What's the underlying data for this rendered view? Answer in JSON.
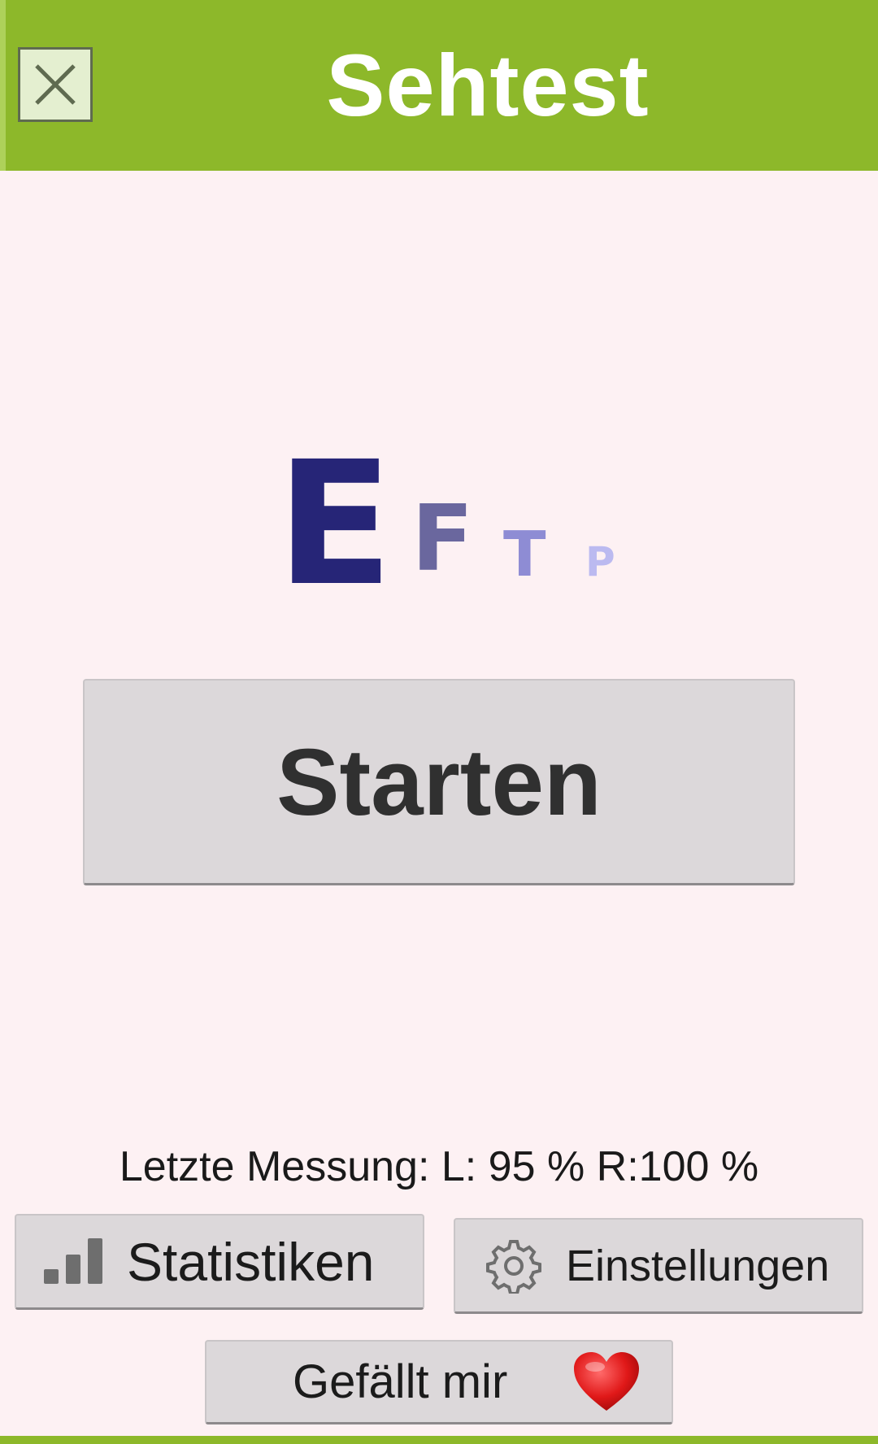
{
  "header": {
    "title": "Sehtest",
    "close_icon": "close-icon",
    "color": "#8db82a"
  },
  "logo": {
    "letters": [
      "E",
      "F",
      "T",
      "P"
    ]
  },
  "main": {
    "start_label": "Starten",
    "last_measurement": "Letzte Messung: L: 95 % R:100 %"
  },
  "buttons": {
    "stats_label": "Statistiken",
    "stats_icon": "bar-chart-icon",
    "settings_label": "Einstellungen",
    "settings_icon": "gear-icon",
    "like_label": "Gefällt mir",
    "like_icon": "heart-icon"
  }
}
